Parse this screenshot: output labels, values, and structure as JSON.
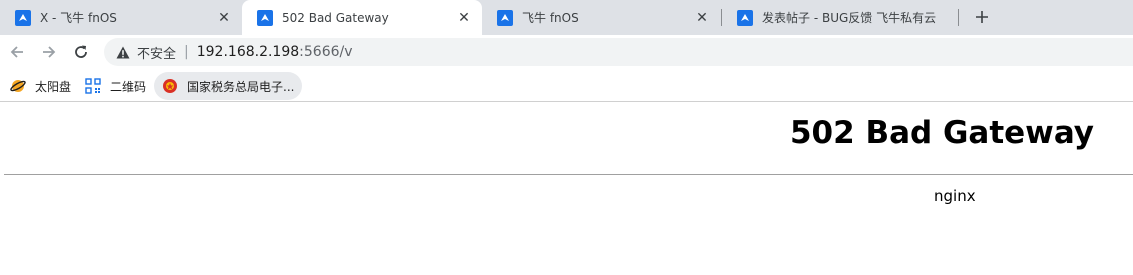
{
  "tabs": [
    {
      "title": "X - 飞牛 fnOS",
      "active": false
    },
    {
      "title": "502 Bad Gateway",
      "active": true
    },
    {
      "title": "飞牛 fnOS",
      "active": false
    },
    {
      "title": "发表帖子 - BUG反馈 飞牛私有云",
      "active": false
    }
  ],
  "toolbar": {
    "security_label": "不安全",
    "divider": "|",
    "url_host": "192.168.2.198",
    "url_path": ":5666/v"
  },
  "bookmarks": [
    {
      "label": "太阳盘",
      "icon": "sun-disc-icon"
    },
    {
      "label": "二维码",
      "icon": "qr-code-icon"
    },
    {
      "label": "国家税务总局电子...",
      "icon": "tax-emblem-icon"
    }
  ],
  "page": {
    "heading": "502 Bad Gateway",
    "server": "nginx"
  },
  "colors": {
    "tabstrip_bg": "#dee1e6",
    "favicon_blue": "#1a73e8",
    "omnibox_bg": "#f1f3f4"
  }
}
